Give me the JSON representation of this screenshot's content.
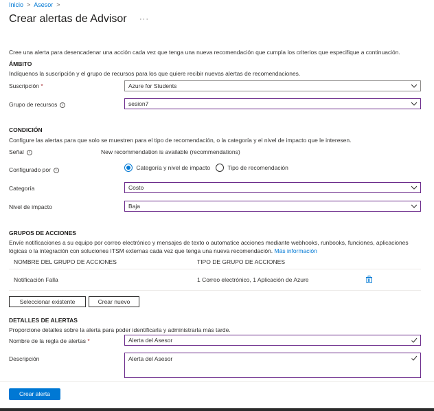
{
  "breadcrumb": {
    "home": "Inicio",
    "parent": "Asesor",
    "sep": ">"
  },
  "page": {
    "title": "Crear alertas de Advisor",
    "menu": "···"
  },
  "intro": "Cree una alerta para desencadenar una acción cada vez que tenga una nueva recomendación que cumpla los criterios que especifique a continuación.",
  "scope": {
    "title": "ÁMBITO",
    "description": "Indíquenos la suscripción y el grupo de recursos para los que quiere recibir nuevas alertas de recomendaciones.",
    "subscription_label": "Suscripción",
    "required_mark": "*",
    "subscription_value": "Azure for Students",
    "resource_group_label": "Grupo de recursos",
    "resource_group_value": "sesion7"
  },
  "condition": {
    "title": "CONDICIÓN",
    "description": "Configure las alertas para que solo se muestren para el tipo de recomendación, o la categoría y el nivel de impacto que le interesen.",
    "signal_label": "Señal",
    "signal_value": "New recommendation is available (recommendations)",
    "configured_by_label": "Configurado por",
    "option_category": "Categoría y nivel de impacto",
    "option_type": "Tipo de recomendación",
    "category_label": "Categoría",
    "category_value": "Costo",
    "impact_label": "Nivel de impacto",
    "impact_value": "Baja"
  },
  "action_groups": {
    "title": "GRUPOS DE ACCIONES",
    "description_line1": "Envíe notificaciones a su equipo por correo electrónico y mensajes de texto o automatice acciones mediante webhooks, runbooks, funciones, aplicaciones",
    "description_line2": "lógicas o la integración con soluciones ITSM externas cada vez que tenga una nueva recomendación.",
    "more_info": "Más información",
    "col_name": "NOMBRE DEL GRUPO DE ACCIONES",
    "col_type": "TIPO DE GRUPO DE ACCIONES",
    "rows": [
      {
        "name": "Notificación Falla",
        "type": "1 Correo electrónico, 1 Aplicación de Azure"
      }
    ],
    "select_existing": "Seleccionar existente",
    "create_new": "Crear nuevo"
  },
  "alert_details": {
    "title": "DETALLES DE ALERTAS",
    "description": "Proporcione detalles sobre la alerta para poder identificarla y administrarla más tarde.",
    "rule_name_label": "Nombre de la regla de alertas",
    "required_mark": "*",
    "rule_name_value": "Alerta del Asesor",
    "description_label": "Descripción",
    "description_value": "Alerta del Asesor"
  },
  "footer": {
    "create_button": "Crear alerta"
  },
  "colors": {
    "accent": "#0078d4",
    "focus_border": "#6b2a8b",
    "required": "#a4262c"
  }
}
